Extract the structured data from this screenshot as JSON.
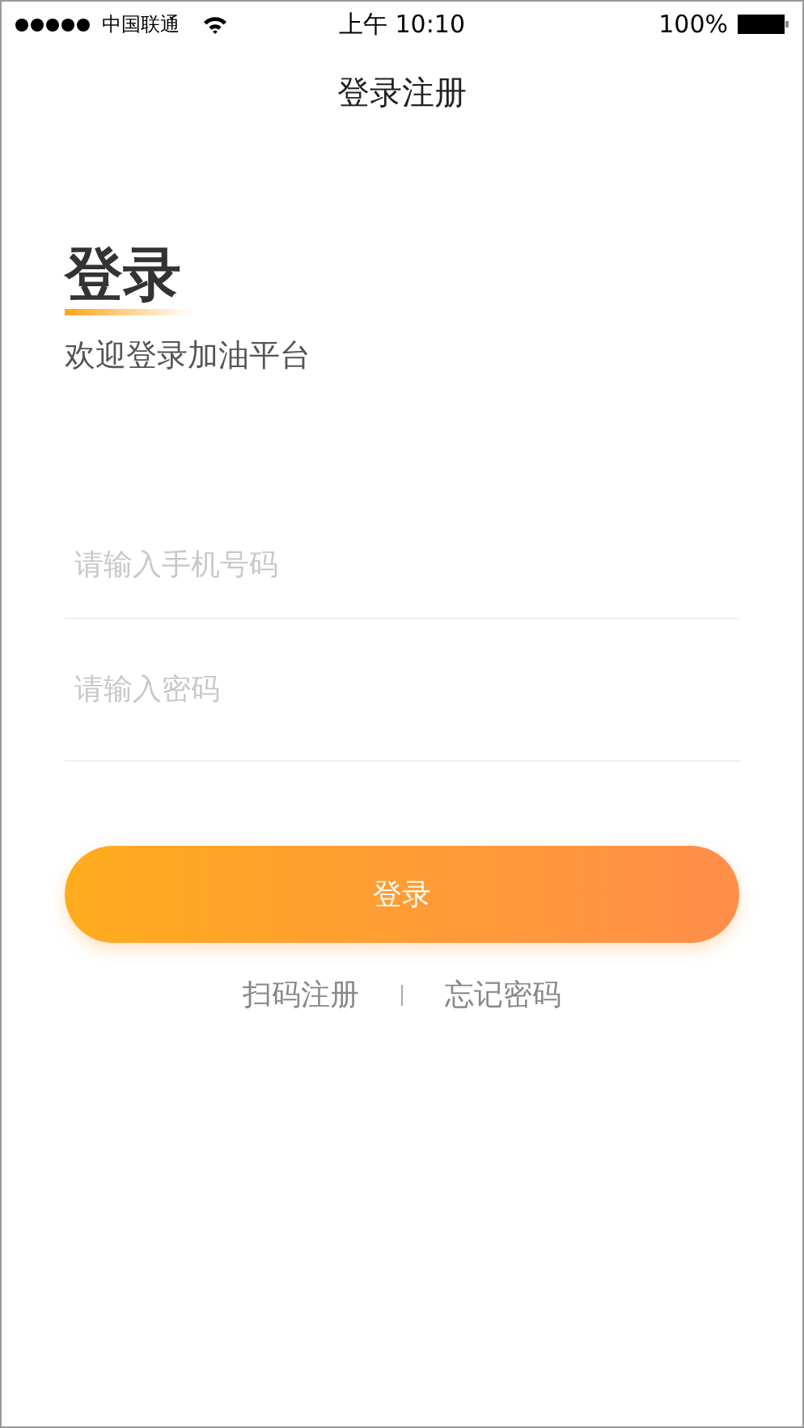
{
  "status_bar": {
    "carrier": "中国联通",
    "time": "上午 10:10",
    "battery": "100%"
  },
  "nav": {
    "title": "登录注册"
  },
  "heading": {
    "title": "登录",
    "subtitle": "欢迎登录加油平台"
  },
  "fields": [
    {
      "placeholder": "请输入手机号码"
    },
    {
      "placeholder": "请输入密码"
    }
  ],
  "login_button": "登录",
  "links": [
    "扫码注册",
    "忘记密码"
  ]
}
